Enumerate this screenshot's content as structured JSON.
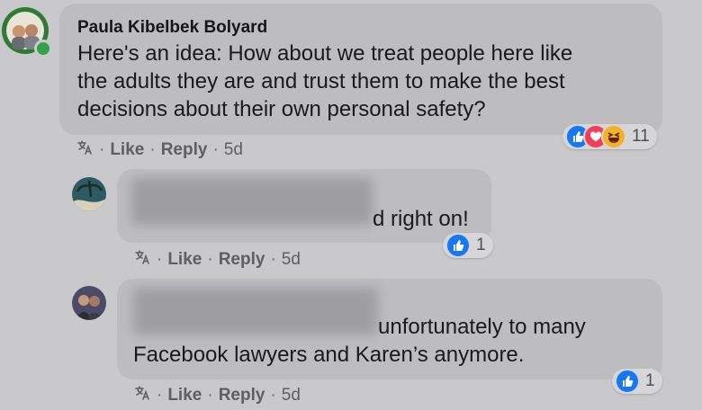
{
  "comments": [
    {
      "author": "Paula Kibelbek Bolyard",
      "lines": [
        "Here's an idea: How about we treat people here like",
        "the adults they are and trust them to make the best",
        "decisions about their own personal safety?"
      ],
      "actions": {
        "like": "Like",
        "reply": "Reply",
        "time": "5d"
      },
      "reactions": {
        "icons": [
          "like-icon",
          "love-icon",
          "haha-icon"
        ],
        "count": "11"
      }
    },
    {
      "author": "",
      "lines": [
        "d right on!"
      ],
      "actions": {
        "like": "Like",
        "reply": "Reply",
        "time": "5d"
      },
      "reactions": {
        "icons": [
          "like-icon"
        ],
        "count": "1"
      }
    },
    {
      "author": "",
      "lines": [
        "unfortunately to many",
        "Facebook lawyers and Karen’s anymore."
      ],
      "actions": {
        "like": "Like",
        "reply": "Reply",
        "time": "5d"
      },
      "reactions": {
        "icons": [
          "like-icon"
        ],
        "count": "1"
      }
    }
  ],
  "separator": "·",
  "colors": {
    "like": "#1877f2",
    "love": "#f33e58",
    "haha": "#f7b125",
    "online": "#31a24c"
  }
}
